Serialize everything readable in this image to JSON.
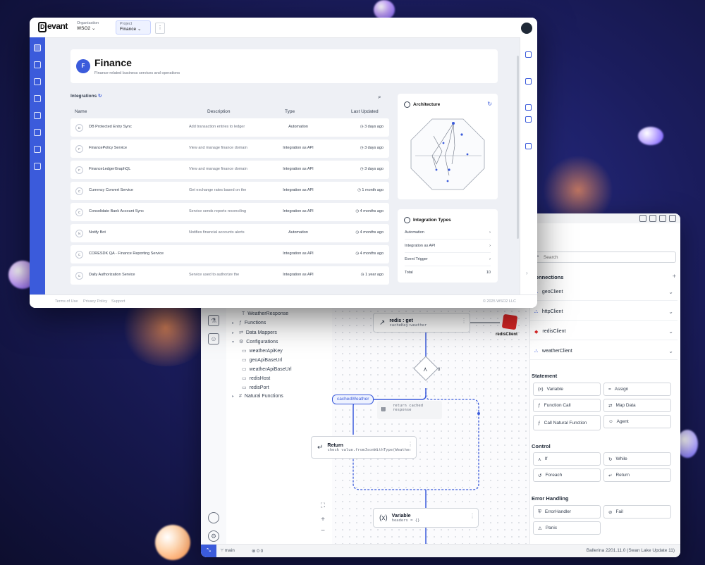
{
  "dashboard": {
    "logo": "evant",
    "org_label": "Organization",
    "org_value": "WSO2",
    "project_label": "Project",
    "project_value": "Finance",
    "title": "Finance",
    "subtitle": "Finance-related business services and operations",
    "integrations_label": "Integrations",
    "columns": [
      "Name",
      "Description",
      "Type",
      "Last Updated"
    ],
    "rows": [
      {
        "initial": "D",
        "name": "DB Protected Entry Sync",
        "desc": "Add transaction entries to ledger",
        "type": "Automation",
        "updated": "3 days ago"
      },
      {
        "initial": "F",
        "name": "FinancePolicy Service",
        "desc": "View and manage finance domain",
        "type": "Integration as API",
        "updated": "3 days ago"
      },
      {
        "initial": "F",
        "name": "FinanceLedgerGraphQL",
        "desc": "View and manage finance domain",
        "type": "Integration as API",
        "updated": "3 days ago"
      },
      {
        "initial": "C",
        "name": "Currency Convert Service",
        "desc": "Get exchange rates based on the",
        "type": "Integration as API",
        "updated": "1 month ago"
      },
      {
        "initial": "C",
        "name": "Consolidate Bank Account Sync",
        "desc": "Service sends reports reconciling",
        "type": "Integration as API",
        "updated": "4 months ago"
      },
      {
        "initial": "N",
        "name": "Notify Bot",
        "desc": "Notifies financial accounts alerts",
        "type": "Automation",
        "updated": "4 months ago"
      },
      {
        "initial": "C",
        "name": "CORESDK QA - Finance Reporting Service",
        "desc": "",
        "type": "Integration as API",
        "updated": "4 months ago"
      },
      {
        "initial": "C",
        "name": "Daily Authorization Service",
        "desc": "Service used to authorize the",
        "type": "Integration as API",
        "updated": "1 year ago"
      }
    ],
    "architecture_title": "Architecture",
    "types_title": "Integration Types",
    "types": [
      {
        "label": "Automation",
        "value": ""
      },
      {
        "label": "Integration as API",
        "value": ""
      },
      {
        "label": "Event Trigger",
        "value": ""
      },
      {
        "label": "Total",
        "value": "10"
      }
    ],
    "footer_links": [
      "Terms of Use",
      "Privacy Policy",
      "Support"
    ],
    "footer_right": "© 2025 WSO2 LLC"
  },
  "editor": {
    "tree": [
      {
        "label": "WeatherResponse",
        "icon": "T",
        "indent": 1
      },
      {
        "label": "Functions",
        "icon": "",
        "indent": 0
      },
      {
        "label": "Data Mappers",
        "icon": "",
        "indent": 0
      },
      {
        "label": "Configurations",
        "icon": "",
        "indent": 0
      },
      {
        "label": "weatherApiKey",
        "icon": "",
        "indent": 1
      },
      {
        "label": "geoApiBaseUrl",
        "icon": "",
        "indent": 1
      },
      {
        "label": "weatherApiBaseUrl",
        "icon": "",
        "indent": 1
      },
      {
        "label": "redisHost",
        "icon": "",
        "indent": 1
      },
      {
        "label": "redisPort",
        "icon": "",
        "indent": 1
      },
      {
        "label": "Natural Functions",
        "icon": "#",
        "indent": 0
      }
    ],
    "nodes": {
      "redis_title": "redis : get",
      "redis_sub": "cacheKey:weather",
      "redis_client": "redisClient",
      "branch_label": "cachedWeather",
      "comment_text": "return cached response",
      "return_title": "Return",
      "return_sub": "check value.fromJsonWithType(WeatherResponse)",
      "variable_title": "Variable",
      "variable_sub": "headers = {}"
    },
    "search_placeholder": "Search",
    "connections_title": "Connections",
    "connections": [
      "geoClient",
      "httpClient",
      "redisClient",
      "weatherClient"
    ],
    "statement_title": "Statement",
    "statement": [
      "Variable",
      "Assign",
      "Function Call",
      "Map Data",
      "Call Natural Function",
      "Agent"
    ],
    "control_title": "Control",
    "control": [
      "If",
      "While",
      "Foreach",
      "Return"
    ],
    "error_title": "Error Handling",
    "error": [
      "ErrorHandler",
      "Fail",
      "Panic"
    ],
    "status_branch": "main",
    "status_counts": "0 0",
    "status_right": "Ballerina 2201.11.0 (Swan Lake Update 11)"
  }
}
